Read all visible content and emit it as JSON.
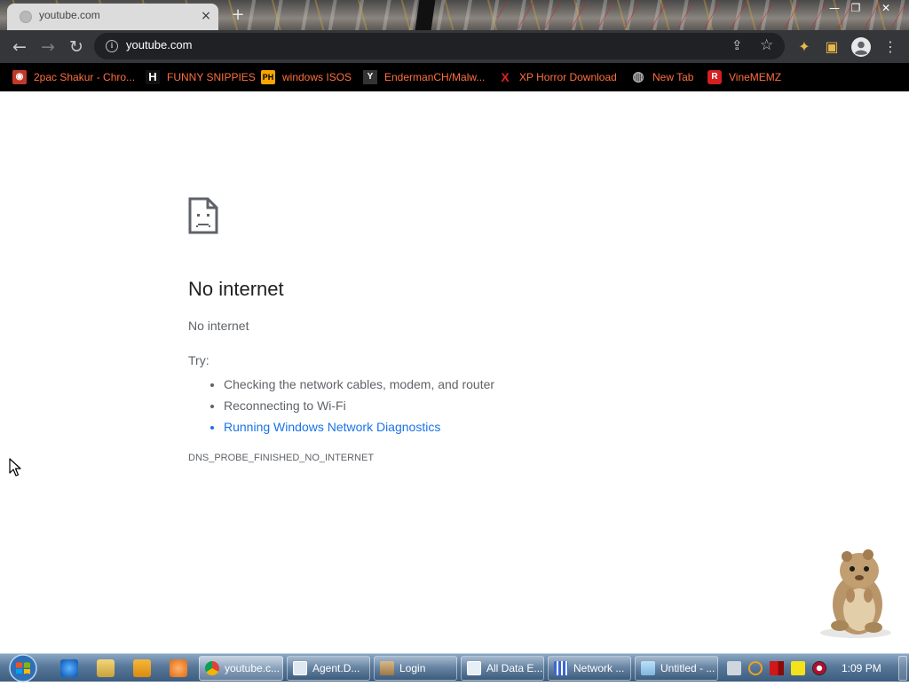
{
  "window": {
    "tab_title": "youtube.com",
    "tab_close": "×",
    "new_tab": "+",
    "controls": {
      "minimize": "—",
      "maximize": "❐",
      "close": "✕"
    }
  },
  "toolbar": {
    "back_icon": "←",
    "forward_icon": "→",
    "reload_icon": "↻",
    "url": "youtube.com",
    "info_icon": "i",
    "share_icon": "⇪",
    "bookmark_star": "☆",
    "extensions_icon": "✦",
    "sidepanel_icon": "▣",
    "menu_icon": "⋮"
  },
  "bookmarks": [
    {
      "label": "2pac Shakur - Chro...",
      "icon": "disc-icon",
      "glyph": "◉",
      "color": "#c0392b"
    },
    {
      "label": "FUNNY SNIPPIES",
      "icon": "h-logo-icon",
      "glyph": "H",
      "color": "#ffffff"
    },
    {
      "label": "windows ISOS",
      "icon": "ph-logo-icon",
      "glyph": "PH",
      "color": "#f7a600"
    },
    {
      "label": "EndermanCH/Malw...",
      "icon": "github-icon",
      "glyph": "Y",
      "color": "#333333"
    },
    {
      "label": "XP Horror Download",
      "icon": "x-icon",
      "glyph": "X",
      "color": "#e02020"
    },
    {
      "label": "New Tab",
      "icon": "globe-icon",
      "glyph": "◍",
      "color": "#8a8a8a"
    },
    {
      "label": "VineMEMZ",
      "icon": "r-logo-icon",
      "glyph": "R",
      "color": "#d42020"
    }
  ],
  "error": {
    "title": "No internet",
    "description": "No internet",
    "try_label": "Try:",
    "suggestions": [
      "Checking the network cables, modem, and router",
      "Reconnecting to Wi-Fi",
      "Running Windows Network Diagnostics"
    ],
    "code": "DNS_PROBE_FINISHED_NO_INTERNET"
  },
  "taskbar": {
    "tasks": [
      {
        "label": "youtube.c...",
        "icon": "chrome-icon",
        "active": true
      },
      {
        "label": "Agent.D...",
        "icon": "agent-icon",
        "active": false
      },
      {
        "label": "Login",
        "icon": "login-icon",
        "active": false
      },
      {
        "label": "All Data E...",
        "icon": "data-icon",
        "active": false
      },
      {
        "label": "Network ...",
        "icon": "network-icon",
        "active": false
      },
      {
        "label": "Untitled - ...",
        "icon": "notepad-icon",
        "active": false
      }
    ],
    "clock": "1:09 PM"
  },
  "colors": {
    "link": "#1a73e8",
    "bookmark_text": "#ff6f3d",
    "toolbar_bg": "#35363a",
    "omnibox_bg": "#202124"
  }
}
